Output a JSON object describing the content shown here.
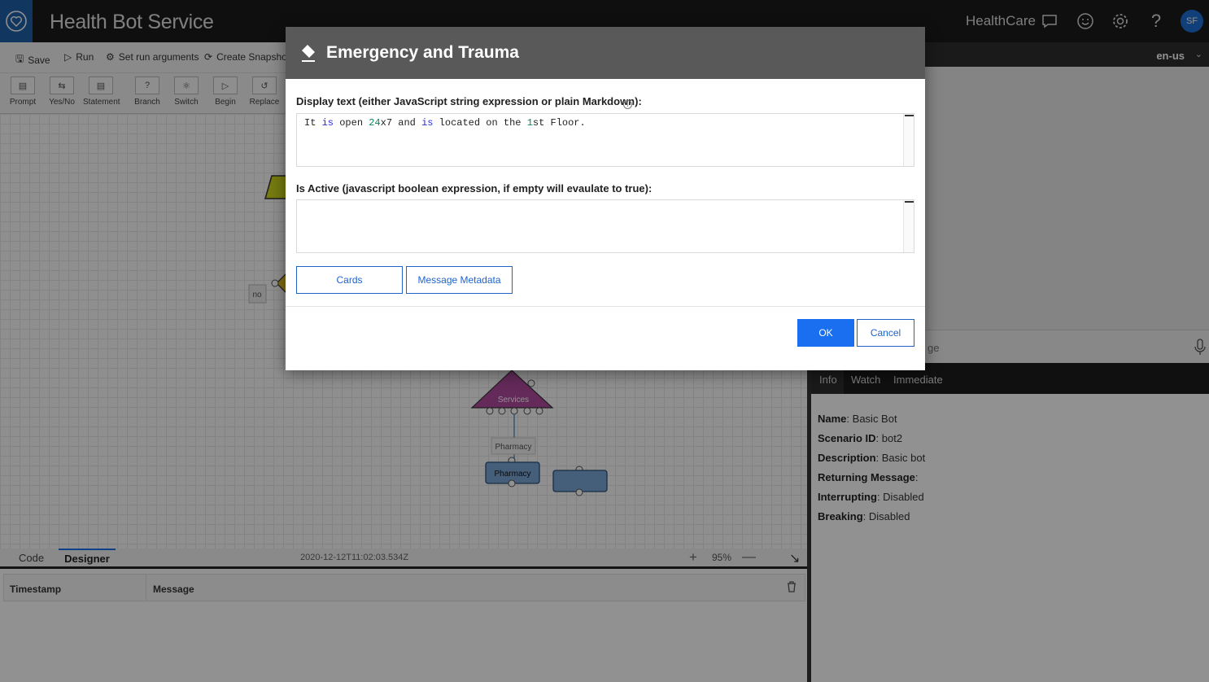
{
  "topbar": {
    "title": "Health Bot Service",
    "tenant": "HealthCare",
    "avatar_initials": "SF"
  },
  "commands": {
    "save": "Save",
    "run": "Run",
    "set_run_arguments": "Set run arguments",
    "create_snapshot": "Create Snapshot"
  },
  "language": "en-us",
  "palette": [
    "Prompt",
    "Yes/No",
    "Statement",
    "Branch",
    "Switch",
    "Begin",
    "Replace"
  ],
  "canvas": {
    "no_label": "no",
    "services": "Services",
    "pharmacy_label": "Pharmacy",
    "pharmacy_node": "Pharmacy"
  },
  "editor": {
    "tab_code": "Code",
    "tab_designer": "Designer",
    "timestamp": "2020-12-12T11:02:03.534Z",
    "zoom": "95%"
  },
  "log": {
    "col_timestamp": "Timestamp",
    "col_message": "Message"
  },
  "chat": {
    "input_placeholder_fragment": "ge"
  },
  "info": {
    "tabs": [
      "Info",
      "Watch",
      "Immediate"
    ],
    "rows": [
      {
        "label": "Name",
        "value": "Basic Bot"
      },
      {
        "label": "Scenario ID",
        "value": "bot2"
      },
      {
        "label": "Description",
        "value": "Basic bot"
      },
      {
        "label": "Returning Message",
        "value": ""
      },
      {
        "label": "Interrupting",
        "value": "Disabled"
      },
      {
        "label": "Breaking",
        "value": "Disabled"
      }
    ]
  },
  "dialog": {
    "title": "Emergency and Trauma",
    "display_label": "Display text (either JavaScript string expression or plain Markdown):",
    "display_code": {
      "t1": "It ",
      "t2": "is",
      "t3": " open ",
      "t4": "24",
      "t5": "x7 and ",
      "t6": "is",
      "t7": " located on the ",
      "t8": "1",
      "t9": "st Floor."
    },
    "active_label": "Is Active (javascript boolean expression, if empty will evaulate to true):",
    "cards_button": "Cards",
    "metadata_button": "Message Metadata",
    "ok": "OK",
    "cancel": "Cancel"
  },
  "colors": {
    "accent": "#1a6ff0",
    "topbar": "#1b1b1b",
    "dialog_header": "#595959"
  }
}
